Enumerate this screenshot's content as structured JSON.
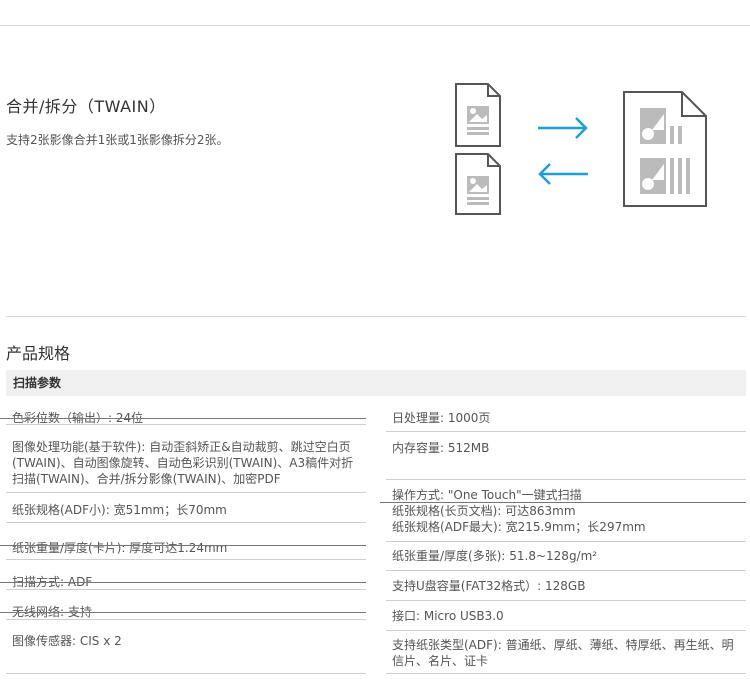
{
  "feature": {
    "title": "合并/拆分（TWAIN）",
    "description": "支持2张影像合并1张或1张影像拆分2张。"
  },
  "icons": {
    "small_doc": "document-image-icon",
    "big_doc": "merged-document-icon",
    "arrow_right": "arrow-right-icon",
    "arrow_left": "arrow-left-icon",
    "accent_color": "#1a9ee0",
    "doc_stroke": "#555555",
    "doc_fill": "#bbbbbb"
  },
  "specs": {
    "title": "产品规格",
    "section": "扫描参数",
    "left": [
      "色彩位数（输出）: 24位",
      "图像处理功能(基于软件): 自动歪斜矫正&自动裁剪、跳过空白页(TWAIN)、自动图像旋转、自动色彩识别(TWAIN)、A3稿件对折扫描(TWAIN)、合并/拆分影像(TWAIN)、加密PDF",
      "纸张规格(ADF小): 宽51mm；长70mm",
      "纸张重量/厚度(卡片): 厚度可达1.24mm",
      "扫描方式: ADF",
      "无线网络: 支持",
      "图像传感器: CIS x 2"
    ],
    "right": [
      "日处理量: 1000页",
      "内存容量: 512MB",
      "操作方式: \"One Touch\"一键式扫描",
      "纸张规格(长页文档): 可达863mm",
      "纸张规格(ADF最大): 宽215.9mm；长297mm",
      "纸张重量/厚度(多张): 51.8~128g/m²",
      "支持U盘容量(FAT32格式）: 128GB",
      "接口: Micro USB3.0",
      "支持纸张类型(ADF): 普通纸、厚纸、薄纸、特厚纸、再生纸、明信片、名片、证卡"
    ]
  }
}
